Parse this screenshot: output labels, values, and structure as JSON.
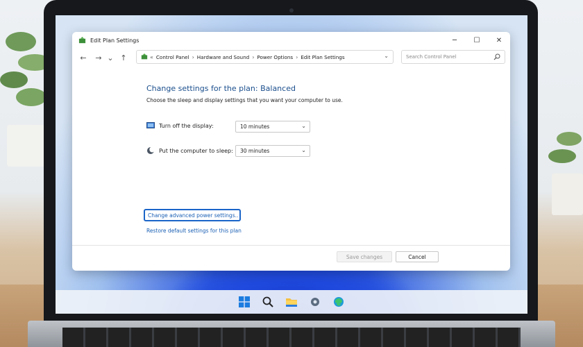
{
  "window": {
    "title": "Edit Plan Settings",
    "controls": {
      "minimize": "─",
      "maximize": "☐",
      "close": "✕"
    }
  },
  "nav": {
    "back": "←",
    "forward": "→",
    "recent": "⌄",
    "up": "↑",
    "breadcrumb": [
      "Control Panel",
      "Hardware and Sound",
      "Power Options",
      "Edit Plan Settings"
    ],
    "breadcrumb_root": "«",
    "search_placeholder": "Search Control Panel"
  },
  "content": {
    "heading": "Change settings for the plan: Balanced",
    "subtext": "Choose the sleep and display settings that you want your computer to use.",
    "display_label": "Turn off the display:",
    "display_value": "10 minutes",
    "sleep_label": "Put the computer to sleep:",
    "sleep_value": "30 minutes",
    "advanced_link": "Change advanced power settings..",
    "restore_link": "Restore default settings for this plan"
  },
  "buttons": {
    "save": "Save changes",
    "cancel": "Cancel"
  },
  "taskbar": {
    "icons": [
      "windows-start-icon",
      "search-icon",
      "file-explorer-icon",
      "settings-icon",
      "edge-icon"
    ]
  },
  "colors": {
    "accent": "#1a64c8",
    "link": "#1a5fb4",
    "heading": "#1a4e8c"
  }
}
